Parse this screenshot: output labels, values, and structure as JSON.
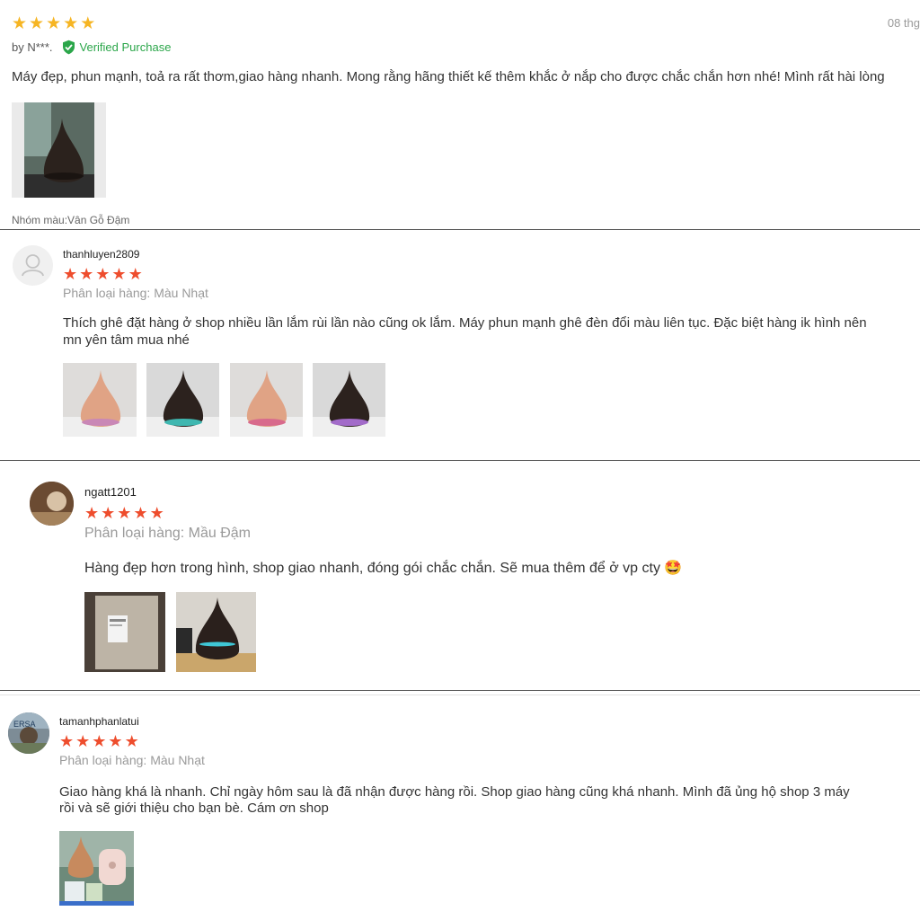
{
  "colors": {
    "gold_star": "#f6b523",
    "red_star": "#ee4d2d",
    "verified_green": "#2ba64a",
    "separator": "#555555"
  },
  "reviews": [
    {
      "rating": 5,
      "date": "08 thg",
      "author_prefix": "by N***.",
      "verified_label": "Verified Purchase",
      "text": "Máy đẹp, phun mạnh, toả ra rất thơm,giao hàng nhanh. Mong rằng hãng thiết kế thêm khắc ở nắp cho được chắc chắn hơn nhé! Mình rất hài lòng",
      "variant": "Nhóm màu:Vân Gỗ Đậm",
      "photo_count": 1
    },
    {
      "username": "thanhluyen2809",
      "rating": 5,
      "variant": "Phân loại hàng: Màu Nhạt",
      "text_line1": "Thích ghê đặt hàng ở shop nhiều lần lắm rùi lần nào cũng ok lắm. Máy phun mạnh ghê đèn đổi màu liên tục. Đặc biệt hàng ik hình nên",
      "text_line2": "mn yên tâm mua nhé",
      "photo_count": 4
    },
    {
      "username": "ngatt1201",
      "rating": 5,
      "variant": "Phân loại hàng: Mầu Đậm",
      "text": "Hàng đẹp hơn trong hình, shop giao nhanh, đóng gói chắc chắn. Sẽ mua thêm để ở vp cty 🤩",
      "photo_count": 2
    },
    {
      "username": "tamanhphanlatui",
      "rating": 5,
      "variant": "Phân loại hàng: Màu Nhạt",
      "text_line1": "Giao hàng khá là nhanh. Chỉ ngày hôm sau là đã nhận được hàng rồi. Shop giao hàng cũng khá nhanh. Mình đã ủng hộ shop 3 máy",
      "text_line2": "rồi và sẽ giới thiệu cho bạn bè. Cám ơn shop",
      "photo_count": 1
    }
  ]
}
